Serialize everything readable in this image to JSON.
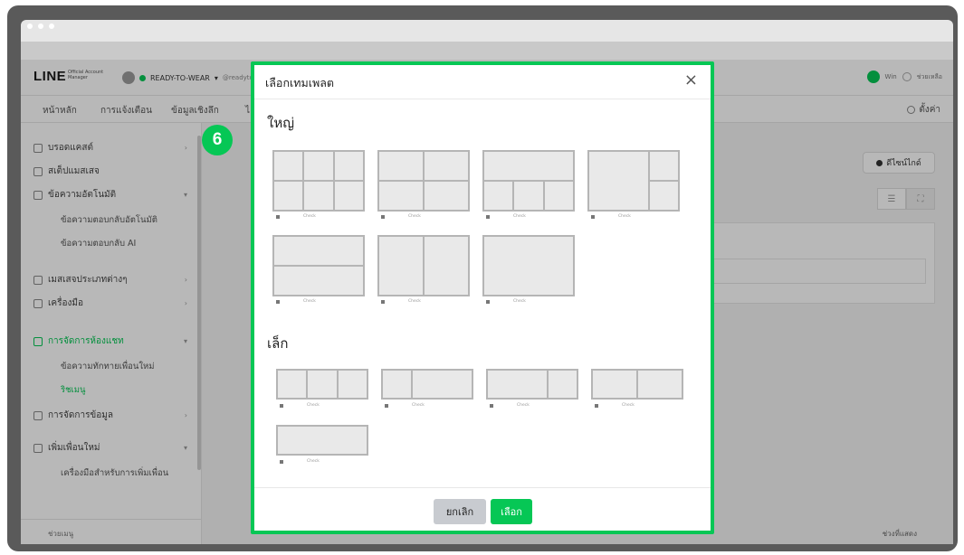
{
  "browser": {
    "dots": 3
  },
  "header": {
    "logo": "LINE",
    "logo_sub": "Official Account Manager",
    "account_name": "READY-TO-WEAR",
    "account_handle": "@readytowear",
    "right_text_1": "Win",
    "right_text_2": "ช่วยเหลือ"
  },
  "tabs": [
    "หน้าหลัก",
    "การแจ้งเตือน",
    "ข้อมูลเชิงลึก",
    "ไ"
  ],
  "settings_label": "ตั้งค่า",
  "sidebar": {
    "items": [
      {
        "label": "บรอดแคสต์"
      },
      {
        "label": "สเต็ปแมสเสจ"
      },
      {
        "label": "ข้อความอัตโนมัติ"
      },
      {
        "label": "ข้อความตอบกลับอัตโนมัติ"
      },
      {
        "label": "ข้อความตอบกลับ AI"
      },
      {
        "label": "เมสเสจประเภทต่างๆ"
      },
      {
        "label": "เครื่องมือ"
      },
      {
        "label": "การจัดการห้องแชท"
      },
      {
        "label": "ข้อความทักทายเพื่อนใหม่"
      },
      {
        "label": "ริชเมนู"
      },
      {
        "label": "การจัดการข้อมูล"
      },
      {
        "label": "เพิ่มเพื่อนใหม่"
      },
      {
        "label": "เครื่องมือสำหรับการเพิ่มเพื่อน"
      }
    ],
    "bottom": "ช่วยเมนู"
  },
  "main": {
    "guide_button": "ดีไซน์ไกด์",
    "bottom_label": "ช่วงที่แสดง"
  },
  "step_number": "6",
  "modal": {
    "title": "เลือกเทมเพลต",
    "close_symbol": "×",
    "large_section": "ใหญ่",
    "small_section": "เล็ก",
    "template_caption": "Check",
    "cancel_label": "ยกเลิก",
    "select_label": "เลือก"
  },
  "colors": {
    "accent": "#06c755",
    "cancel_bg": "#c8cbd0"
  }
}
